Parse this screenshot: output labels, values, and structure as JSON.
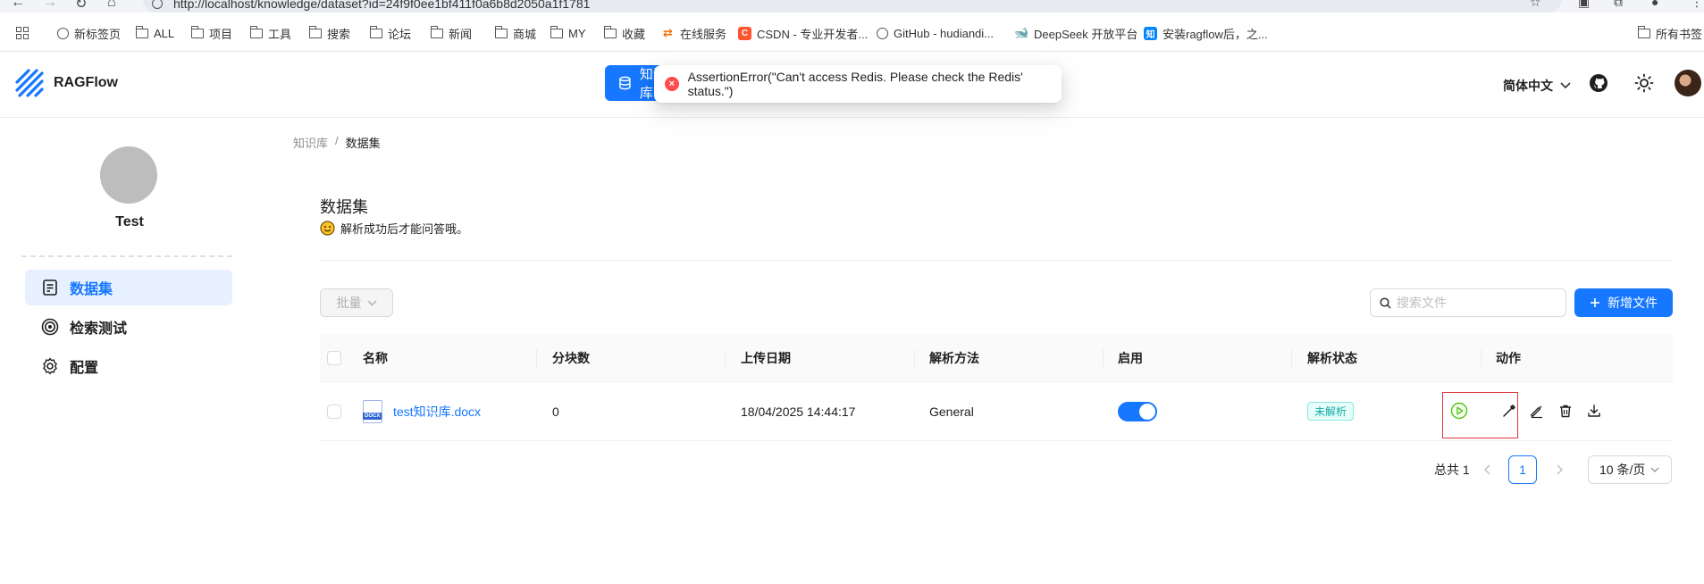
{
  "browser": {
    "url": "http://localhost/knowledge/dataset?id=24f9f0ee1bf411f0a6b8d2050a1f1781",
    "bookmarks": [
      {
        "label": "新标签页",
        "icon": "globe-icon"
      },
      {
        "label": "ALL",
        "icon": "folder-icon"
      },
      {
        "label": "项目",
        "icon": "folder-icon"
      },
      {
        "label": "工具",
        "icon": "folder-icon"
      },
      {
        "label": "搜索",
        "icon": "folder-icon"
      },
      {
        "label": "论坛",
        "icon": "folder-icon"
      },
      {
        "label": "新闻",
        "icon": "folder-icon"
      },
      {
        "label": "商城",
        "icon": "folder-icon"
      },
      {
        "label": "MY",
        "icon": "folder-icon"
      },
      {
        "label": "收藏",
        "icon": "folder-icon"
      },
      {
        "label": "在线服务",
        "icon": "link-icon"
      },
      {
        "label": "CSDN - 专业开发者...",
        "icon": "csdn-icon"
      },
      {
        "label": "GitHub - hudiandi...",
        "icon": "globe-icon"
      },
      {
        "label": "DeepSeek 开放平台",
        "icon": "deepseek-icon"
      },
      {
        "label": "安装ragflow后，之...",
        "icon": "zhihu-icon"
      }
    ],
    "all_bookmarks": "所有书签",
    "csdn_letter": "C",
    "zhihu_letter": "知"
  },
  "header": {
    "app_name": "RAGFlow",
    "active_tab": "知识库",
    "language": "简体中文"
  },
  "toast": {
    "message": "AssertionError(\"Can't access Redis. Please check the Redis' status.\")",
    "type": "error",
    "color": "#ff4d4f"
  },
  "sidebar": {
    "kb_name": "Test",
    "items": [
      {
        "label": "数据集",
        "icon": "dataset-icon",
        "active": true
      },
      {
        "label": "检索测试",
        "icon": "target-icon",
        "active": false
      },
      {
        "label": "配置",
        "icon": "gear-icon",
        "active": false
      }
    ]
  },
  "breadcrumb": {
    "root": "知识库",
    "sep": "/",
    "current": "数据集"
  },
  "page": {
    "title": "数据集",
    "description": "解析成功后才能问答哦。"
  },
  "toolbar": {
    "batch_label": "批量",
    "search_placeholder": "搜索文件",
    "add_label": "新增文件"
  },
  "table": {
    "columns": [
      "名称",
      "分块数",
      "上传日期",
      "解析方法",
      "启用",
      "解析状态",
      "动作"
    ],
    "rows": [
      {
        "name": "test知识库.docx",
        "file_type": "DOCX",
        "chunks": "0",
        "upload_date": "18/04/2025 14:44:17",
        "parse_method": "General",
        "enabled": true,
        "status": "未解析",
        "actions": [
          "run-icon",
          "tool-icon",
          "edit-icon",
          "delete-icon",
          "download-icon"
        ]
      }
    ]
  },
  "pagination": {
    "total_label": "总共 1",
    "current_page": "1",
    "page_size": "10 条/页"
  },
  "colors": {
    "primary": "#1677ff",
    "error": "#ff4d4f",
    "tag_text": "#13a8a8",
    "run_green": "#52c41a"
  }
}
